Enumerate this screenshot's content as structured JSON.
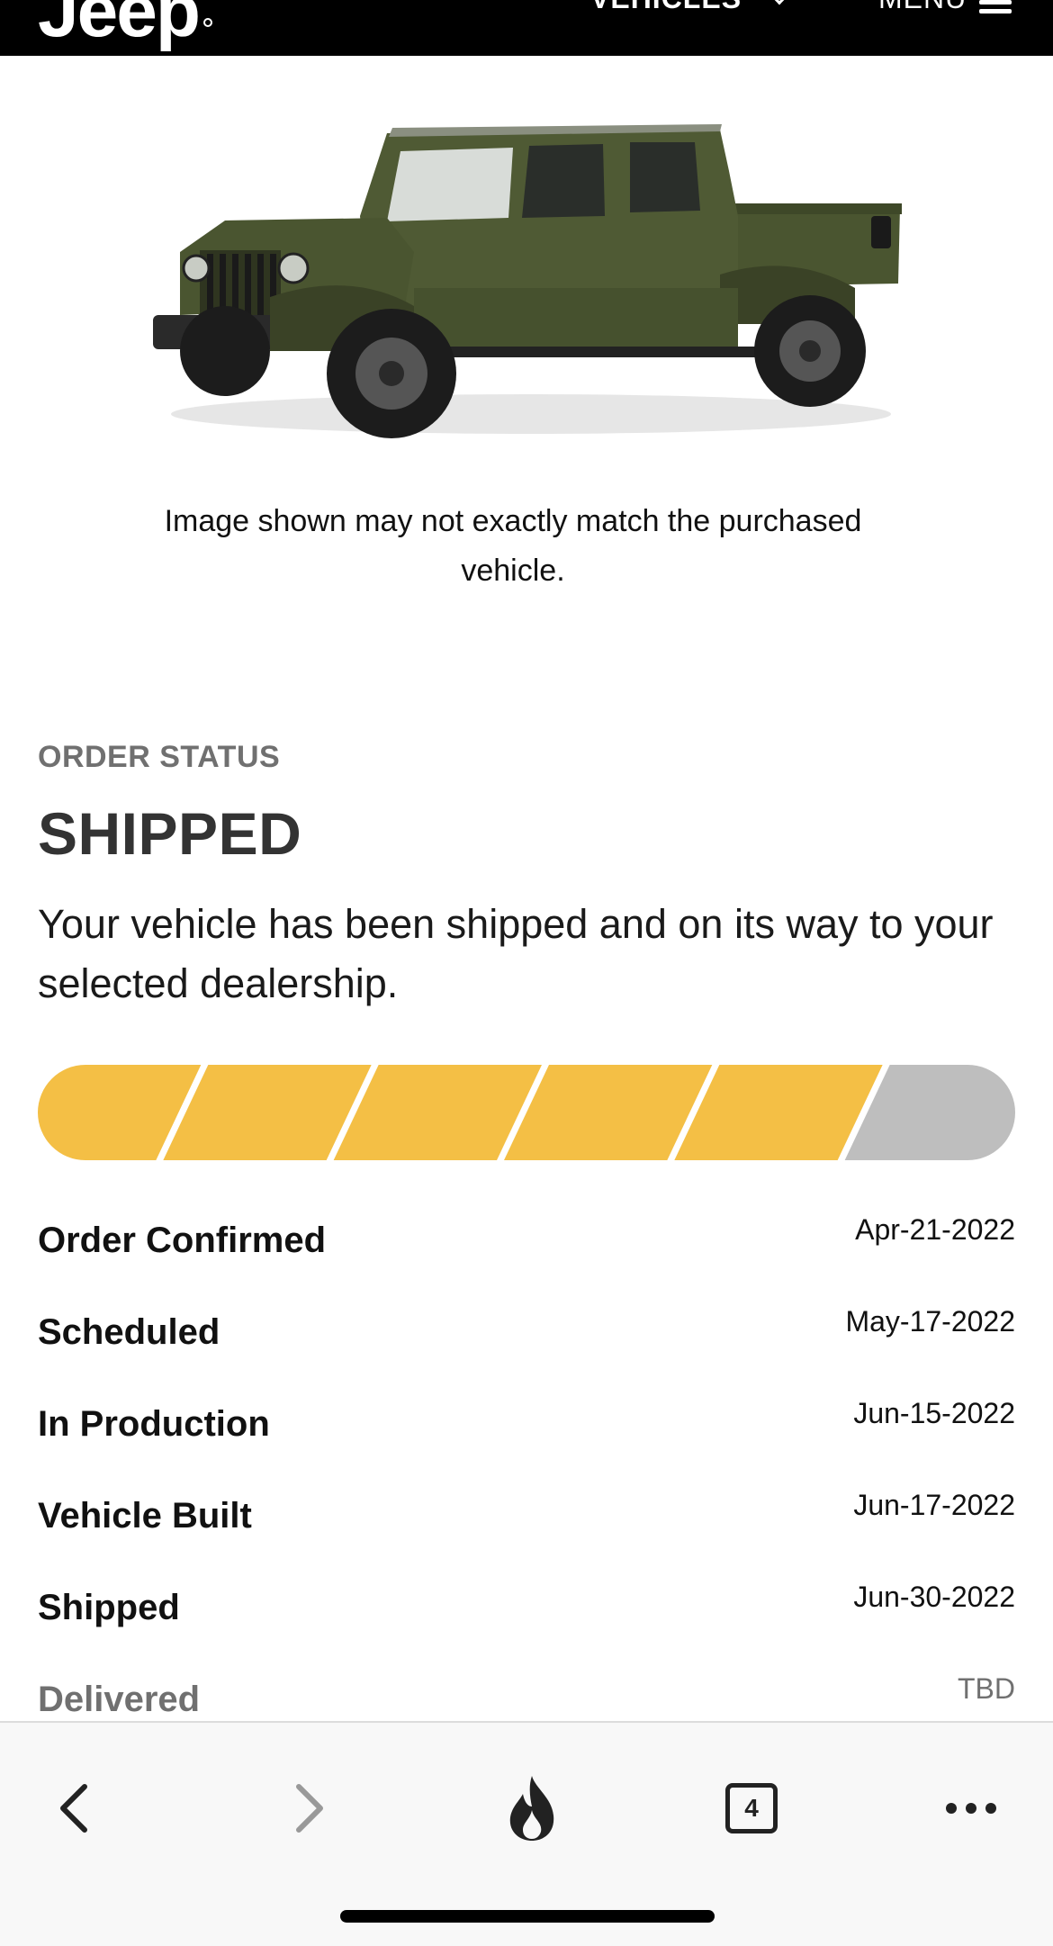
{
  "header": {
    "logo_text": "Jeep",
    "nav_vehicles": "VEHICLES",
    "nav_menu": "MENU"
  },
  "vehicle": {
    "image_description_icon": "jeep-gladiator-truck-illustration",
    "body_color": "#4a5530",
    "disclaimer": "Image shown may not exactly match the purchased vehicle."
  },
  "order_status": {
    "label": "ORDER STATUS",
    "title": "SHIPPED",
    "description": "Your vehicle has been shipped and on its way to your selected dealership.",
    "progress": {
      "completed_steps": 5,
      "total_steps": 6,
      "filled_color": "#f4bf45",
      "empty_color": "#bebebe"
    },
    "milestones": [
      {
        "label": "Order Confirmed",
        "date": "Apr-21-2022",
        "complete": true
      },
      {
        "label": "Scheduled",
        "date": "May-17-2022",
        "complete": true
      },
      {
        "label": "In Production",
        "date": "Jun-15-2022",
        "complete": true
      },
      {
        "label": "Vehicle Built",
        "date": "Jun-17-2022",
        "complete": true
      },
      {
        "label": "Shipped",
        "date": "Jun-30-2022",
        "complete": true
      },
      {
        "label": "Delivered",
        "date": "TBD",
        "complete": false
      }
    ]
  },
  "browser_toolbar": {
    "back_icon": "chevron-left-icon",
    "forward_icon": "chevron-right-icon",
    "burn_icon": "flame-icon",
    "tab_count": "4",
    "more_icon": "more-horizontal-icon"
  }
}
